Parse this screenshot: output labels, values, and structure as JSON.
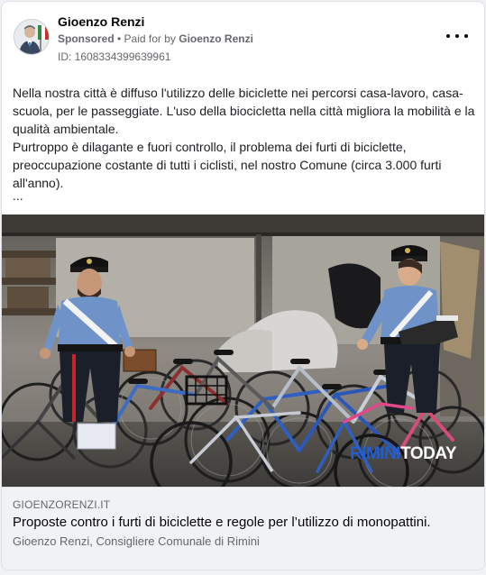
{
  "post": {
    "page_name": "Gioenzo Renzi",
    "sponsored_label": "Sponsored",
    "separator": " • ",
    "paid_for_by_label": "Paid for by ",
    "paid_for_by_name": "Gioenzo Renzi",
    "ad_id": "ID: 1608334399639961",
    "more_icon": "more-horizontal-icon",
    "body_paragraph_1": "Nella nostra città è diffuso l'utilizzo delle biciclette nei percorsi casa-lavoro, casa-scuola, per le passeggiate. L'uso della biocicletta nella città migliora la mobilità e la qualità ambientale.",
    "body_paragraph_2": "Purtroppo è dilagante e fuori controllo, il problema dei furti di biciclette, preoccupazione costante di tutti i ciclisti, nel nostro Comune (circa 3.000 furti all'anno).",
    "body_ellipsis": "..."
  },
  "media": {
    "watermark_part_1": "RIMINI",
    "watermark_part_2": "TODAY"
  },
  "link": {
    "domain": "GIOENZORENZI.IT",
    "title": "Proposte contro i furti di biciclette e regole per l’utilizzo di monopattini.",
    "description": "Gioenzo Renzi, Consigliere Comunale di Rimini"
  },
  "colors": {
    "uniform_shirt": "#6f93c9",
    "uniform_trousers": "#1b1f2a",
    "stripe_red": "#c0272d",
    "watermark_blue": "#1e5fd6"
  }
}
